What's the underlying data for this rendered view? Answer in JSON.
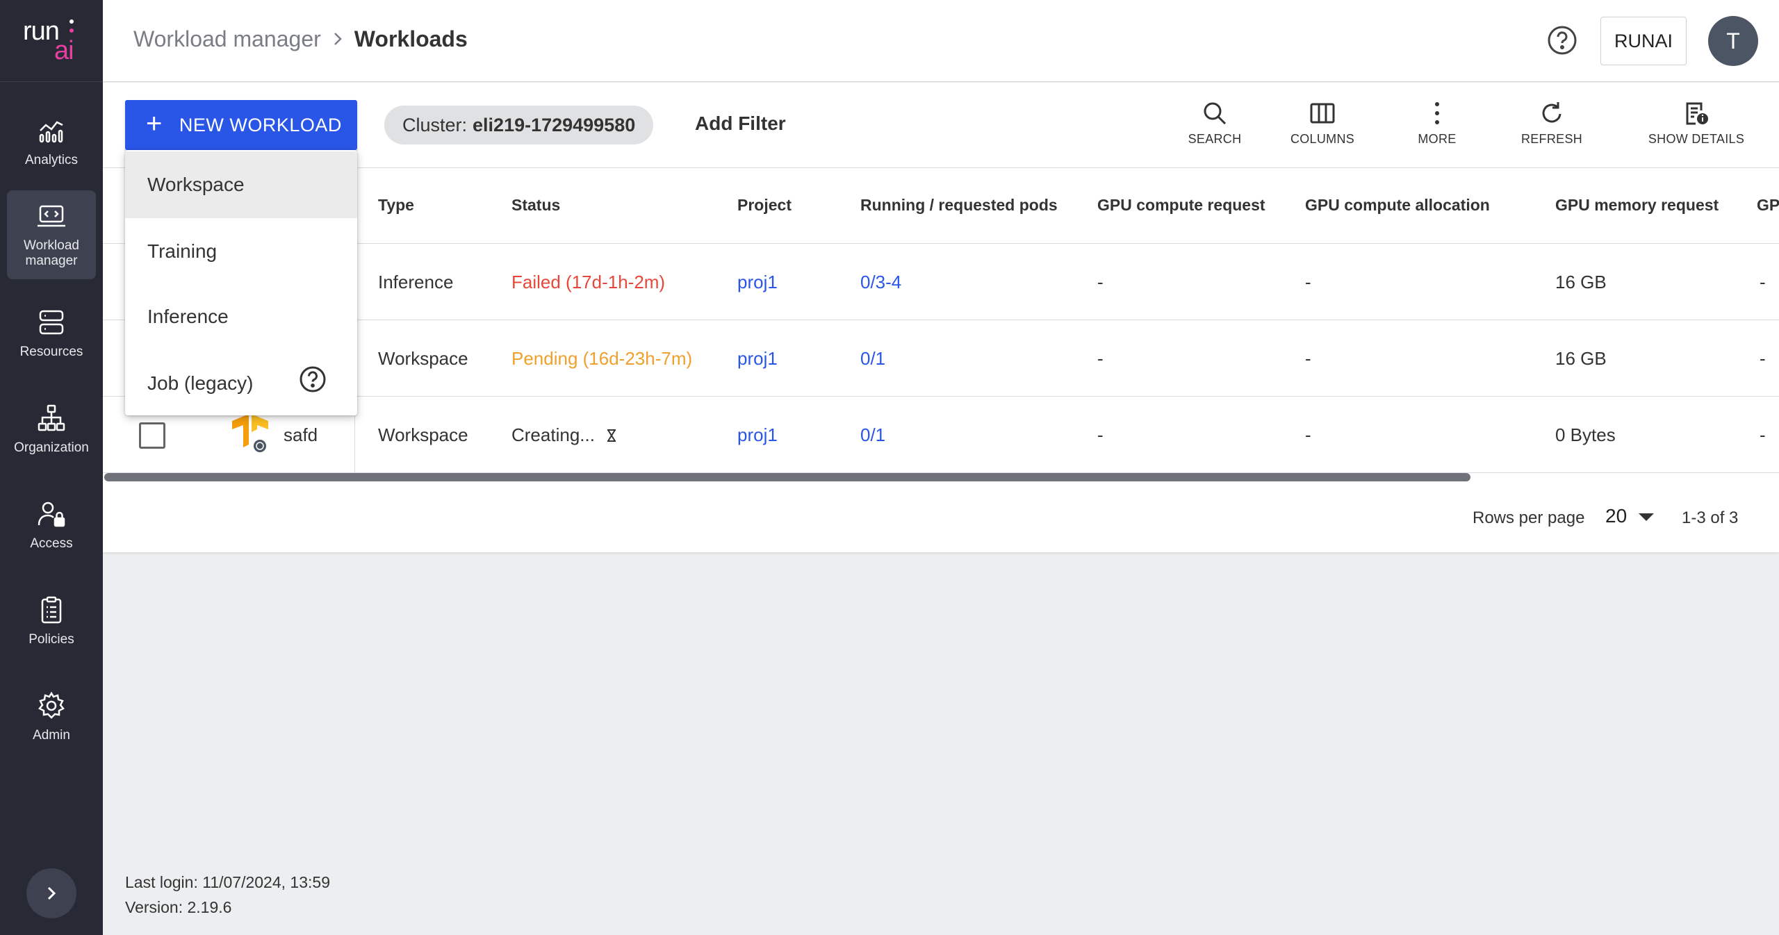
{
  "logo": {
    "run": "run",
    "ai": "ai"
  },
  "sidebar": {
    "items": [
      {
        "label": "Analytics",
        "icon": "analytics-icon"
      },
      {
        "label": "Workload manager",
        "icon": "workload-icon"
      },
      {
        "label": "Resources",
        "icon": "resources-icon"
      },
      {
        "label": "Organization",
        "icon": "organization-icon"
      },
      {
        "label": "Access",
        "icon": "access-icon"
      },
      {
        "label": "Policies",
        "icon": "policies-icon"
      },
      {
        "label": "Admin",
        "icon": "gear-icon"
      }
    ]
  },
  "header": {
    "breadcrumb": [
      "Workload manager",
      "Workloads"
    ],
    "tenant": "RUNAI",
    "avatar_initial": "T"
  },
  "toolbar": {
    "new_workload": "NEW WORKLOAD",
    "cluster_label": "Cluster:",
    "cluster_value": "eli219-1729499580",
    "add_filter": "Add Filter",
    "actions": [
      "SEARCH",
      "COLUMNS",
      "MORE",
      "REFRESH",
      "SHOW DETAILS"
    ]
  },
  "table": {
    "columns": [
      "Type",
      "Status",
      "Project",
      "Running / requested pods",
      "GPU compute request",
      "GPU compute allocation",
      "GPU memory request",
      "GP"
    ],
    "rows": [
      {
        "name": "",
        "type": "Inference",
        "status": "Failed (17d-1h-2m)",
        "project": "proj1",
        "pods": "0/3-4",
        "gpu_req": "-",
        "gpu_alloc": "-",
        "gpu_mem": "16 GB",
        "next": "-"
      },
      {
        "name": "",
        "type": "Workspace",
        "status": "Pending (16d-23h-7m)",
        "project": "proj1",
        "pods": "0/1",
        "gpu_req": "-",
        "gpu_alloc": "-",
        "gpu_mem": "16 GB",
        "next": "-"
      },
      {
        "name": "safd",
        "type": "Workspace",
        "status": "Creating...",
        "project": "proj1",
        "pods": "0/1",
        "gpu_req": "-",
        "gpu_alloc": "-",
        "gpu_mem": "0 Bytes",
        "next": "-"
      }
    ]
  },
  "pagination": {
    "rows_per_page_label": "Rows per page",
    "rows_per_page": "20",
    "range": "1-3 of 3"
  },
  "dropdown": {
    "items": [
      "Workspace",
      "Training",
      "Inference",
      "Job (legacy)"
    ]
  },
  "footer": {
    "last_login": "Last login: 11/07/2024, 13:59",
    "version": "Version: 2.19.6"
  },
  "colors": {
    "primary": "#2a56e8",
    "failed": "#e5483b",
    "pending": "#f0a02c",
    "sidebar": "#272a34"
  }
}
